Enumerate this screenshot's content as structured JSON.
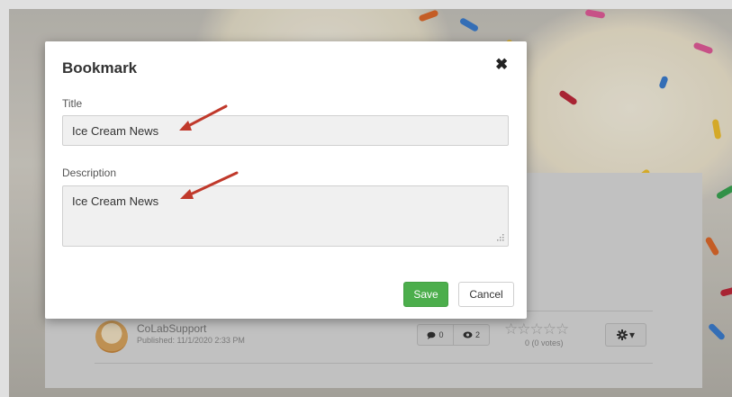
{
  "modal": {
    "title": "Bookmark",
    "close_glyph": "✖",
    "title_label": "Title",
    "title_value": "Ice Cream News",
    "description_label": "Description",
    "description_value": "Ice Cream News",
    "save_label": "Save",
    "cancel_label": "Cancel"
  },
  "post": {
    "author": "CoLabSupport",
    "published": "Published: 11/1/2020 2:33 PM",
    "comments_count": "0",
    "views_count": "2",
    "rating_stars": "☆☆☆☆☆",
    "votes": "0 (0 votes)",
    "gear_glyph": "✿",
    "dropdown_glyph": "▾"
  },
  "icons": {
    "comment": "comment-icon",
    "eye": "eye-icon",
    "gear": "gear-icon",
    "close": "close-icon"
  },
  "colors": {
    "save_button": "#4cae4c",
    "annotation_arrow": "#c0392b",
    "frame": "#3a8a9a"
  }
}
